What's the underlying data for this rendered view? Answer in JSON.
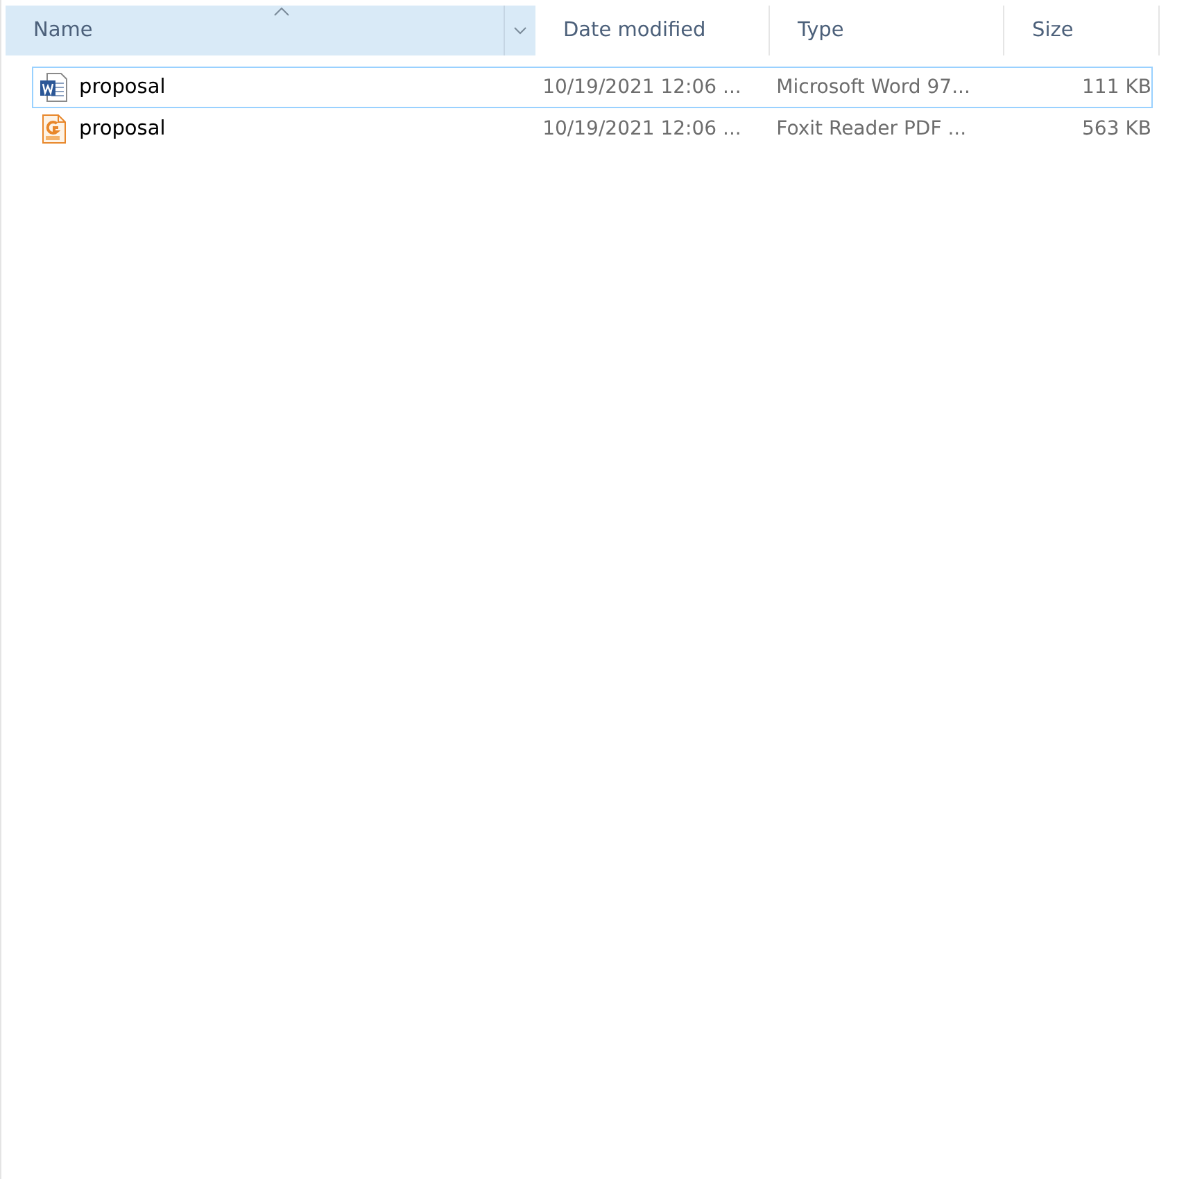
{
  "columns": [
    {
      "label": "Name",
      "sorted": true
    },
    {
      "label": "Date modified",
      "sorted": false
    },
    {
      "label": "Type",
      "sorted": false
    },
    {
      "label": "Size",
      "sorted": false
    }
  ],
  "files": [
    {
      "kind": "word",
      "name": "proposal",
      "date": "10/19/2021 12:06 ...",
      "type": "Microsoft Word 97...",
      "size": "111 KB",
      "focused": true
    },
    {
      "kind": "pdf",
      "name": "proposal",
      "date": "10/19/2021 12:06 ...",
      "type": "Foxit Reader PDF ...",
      "size": "563 KB",
      "focused": false
    }
  ]
}
